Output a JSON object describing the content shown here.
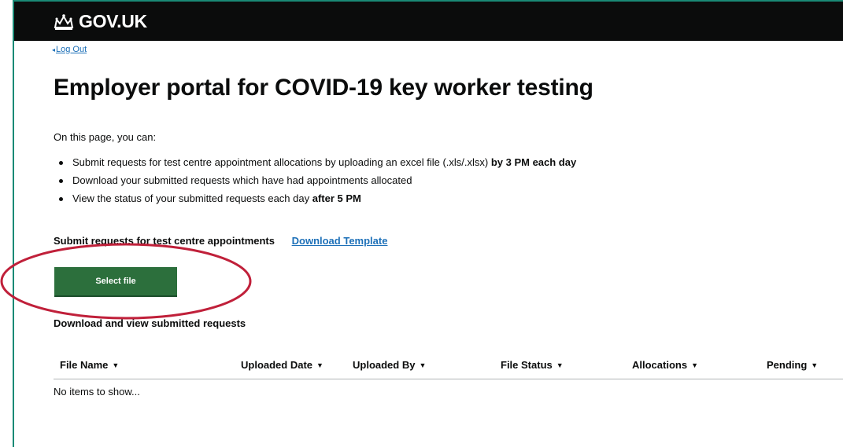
{
  "header": {
    "logo_text": "GOV.UK",
    "logo_icon": "crown-icon"
  },
  "nav": {
    "back_link": "Log Out"
  },
  "page": {
    "title": "Employer portal for COVID-19 key worker testing"
  },
  "intro": {
    "lead": "On this page, you can:",
    "items": [
      {
        "text": "Submit requests for test centre appointment allocations by uploading an excel file (.xls/.xlsx) ",
        "strong": "by 3 PM each day"
      },
      {
        "text": "Download your submitted requests which have had appointments allocated",
        "strong": ""
      },
      {
        "text": "View the status of your submitted requests each day ",
        "strong": "after 5 PM"
      }
    ]
  },
  "submit": {
    "label": "Submit requests for test centre appointments",
    "template_link": "Download Template",
    "button": "Select file"
  },
  "submitted": {
    "title": "Download and view submitted requests",
    "columns": [
      "File Name",
      "Uploaded Date",
      "Uploaded By",
      "File Status",
      "Allocations",
      "Pending"
    ],
    "empty_text": "No items to show..."
  },
  "colors": {
    "header_bg": "#0b0c0c",
    "link": "#1d70b8",
    "button_bg": "#2c6f3c",
    "annotation": "#c0203a",
    "frame": "#1a8a76"
  }
}
